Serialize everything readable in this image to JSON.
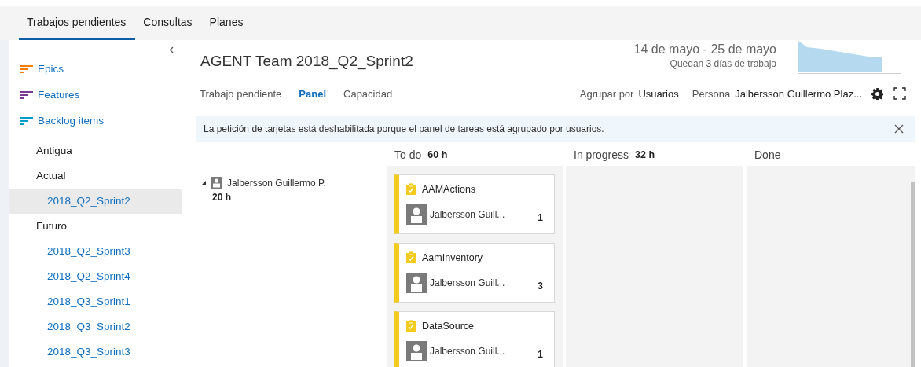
{
  "tabs": [
    {
      "label": "Trabajos pendientes",
      "selected": true
    },
    {
      "label": "Consultas",
      "selected": false
    },
    {
      "label": "Planes",
      "selected": false
    }
  ],
  "sidebar": {
    "backlog_levels": [
      {
        "label": "Epics",
        "color": "#ff7b00"
      },
      {
        "label": "Features",
        "color": "#773b93"
      },
      {
        "label": "Backlog items",
        "color": "#009ccc"
      }
    ],
    "sprints": [
      {
        "label": "Antigua"
      },
      {
        "label": "Actual",
        "children": [
          {
            "label": "2018_Q2_Sprint2",
            "selected": true
          }
        ]
      },
      {
        "label": "Futuro",
        "children": [
          {
            "label": "2018_Q2_Sprint3",
            "selected": false
          },
          {
            "label": "2018_Q2_Sprint4",
            "selected": false
          },
          {
            "label": "2018_Q3_Sprint1",
            "selected": false
          },
          {
            "label": "2018_Q3_Sprint2",
            "selected": false
          },
          {
            "label": "2018_Q3_Sprint3",
            "selected": false
          }
        ]
      }
    ]
  },
  "header": {
    "title": "AGENT Team 2018_Q2_Sprint2",
    "date_range": "14 de mayo - 25 de mayo",
    "days_left": "Quedan 3 días de trabajo"
  },
  "views": [
    {
      "label": "Trabajo pendiente",
      "selected": false
    },
    {
      "label": "Panel",
      "selected": true
    },
    {
      "label": "Capacidad",
      "selected": false
    }
  ],
  "group_by": {
    "label": "Agrupar por",
    "value": "Usuarios"
  },
  "person": {
    "label": "Persona",
    "value": "Jalbersson Guillermo Plaz..."
  },
  "notice": {
    "text": "La petición de tarjetas está deshabilitada porque el panel de tareas está agrupado por usuarios."
  },
  "board": {
    "columns": [
      {
        "name": "To do",
        "hours": "60 h"
      },
      {
        "name": "In progress",
        "hours": "32 h"
      },
      {
        "name": "Done"
      }
    ],
    "swimlane": {
      "name": "Jalbersson Guillermo P.",
      "hours": "20 h",
      "expanded": true
    },
    "cards": [
      {
        "title": "AAMActions",
        "assignee": "Jalbersson Guill...",
        "remaining": "1"
      },
      {
        "title": "AamInventory",
        "assignee": "Jalbersson Guill...",
        "remaining": "3"
      },
      {
        "title": "DataSource",
        "assignee": "Jalbersson Guill...",
        "remaining": "1"
      }
    ]
  }
}
